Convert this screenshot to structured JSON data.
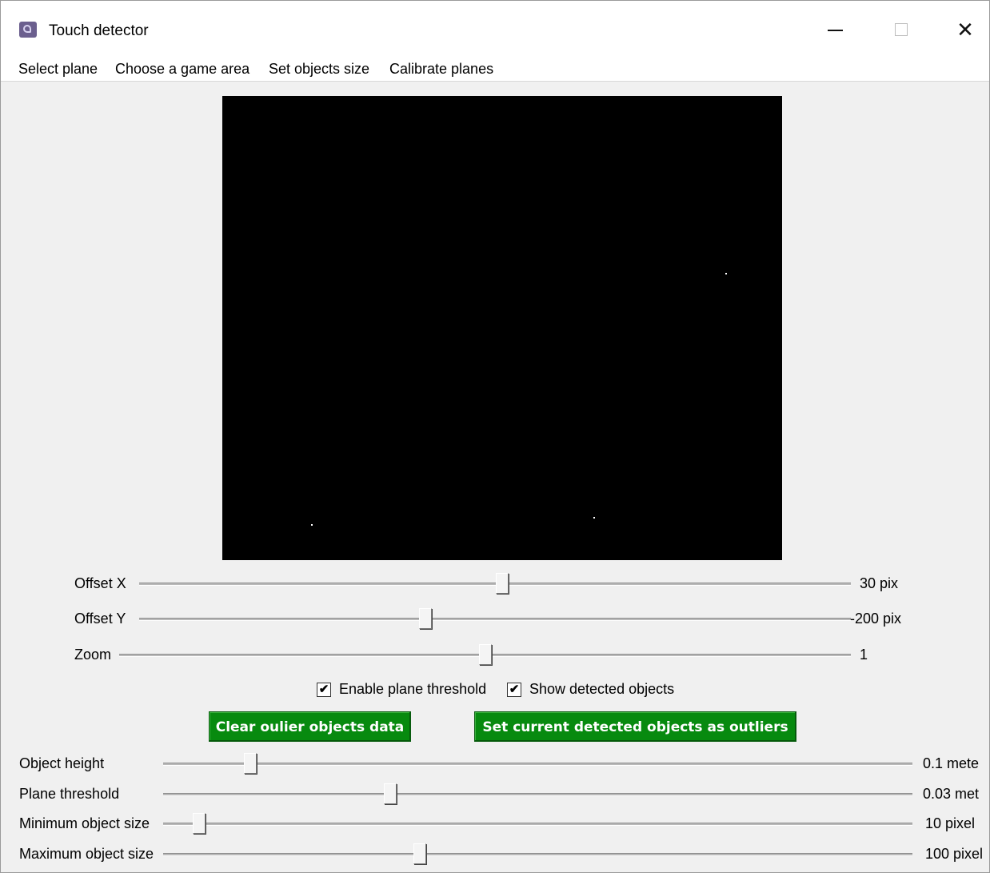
{
  "window": {
    "title": "Touch detector",
    "minimize_glyph": "—",
    "close_glyph": "✕"
  },
  "menu": [
    "Select plane",
    "Choose a game area",
    "Set objects size",
    "Calibrate planes"
  ],
  "view_sliders": [
    {
      "label": "Offset X",
      "value": "30 pix",
      "level": 0.51
    },
    {
      "label": "Offset Y",
      "value": "-200 pix",
      "level": 0.4
    },
    {
      "label": "Zoom",
      "value": "1",
      "level": 0.5
    }
  ],
  "checkboxes": [
    {
      "label": "Enable plane threshold",
      "checked": true,
      "glyph": "✔"
    },
    {
      "label": "Show detected objects",
      "checked": true,
      "glyph": "✔"
    }
  ],
  "buttons": {
    "clear": "Clear oulier objects data",
    "set_outliers": "Set current detected objects as outliers"
  },
  "param_sliders": [
    {
      "label": "Object height",
      "value": "0.1 mete",
      "level": 0.11
    },
    {
      "label": "Plane threshold",
      "value": "0.03 met",
      "level": 0.3
    },
    {
      "label": "Minimum object size",
      "value": "10 pixel",
      "level": 0.04
    },
    {
      "label": "Maximum object size",
      "value": "100 pixel",
      "level": 0.34
    }
  ],
  "colors": {
    "button_green": "#078a0f",
    "canvas": "#000000",
    "window_bg": "#f0f0f0"
  }
}
